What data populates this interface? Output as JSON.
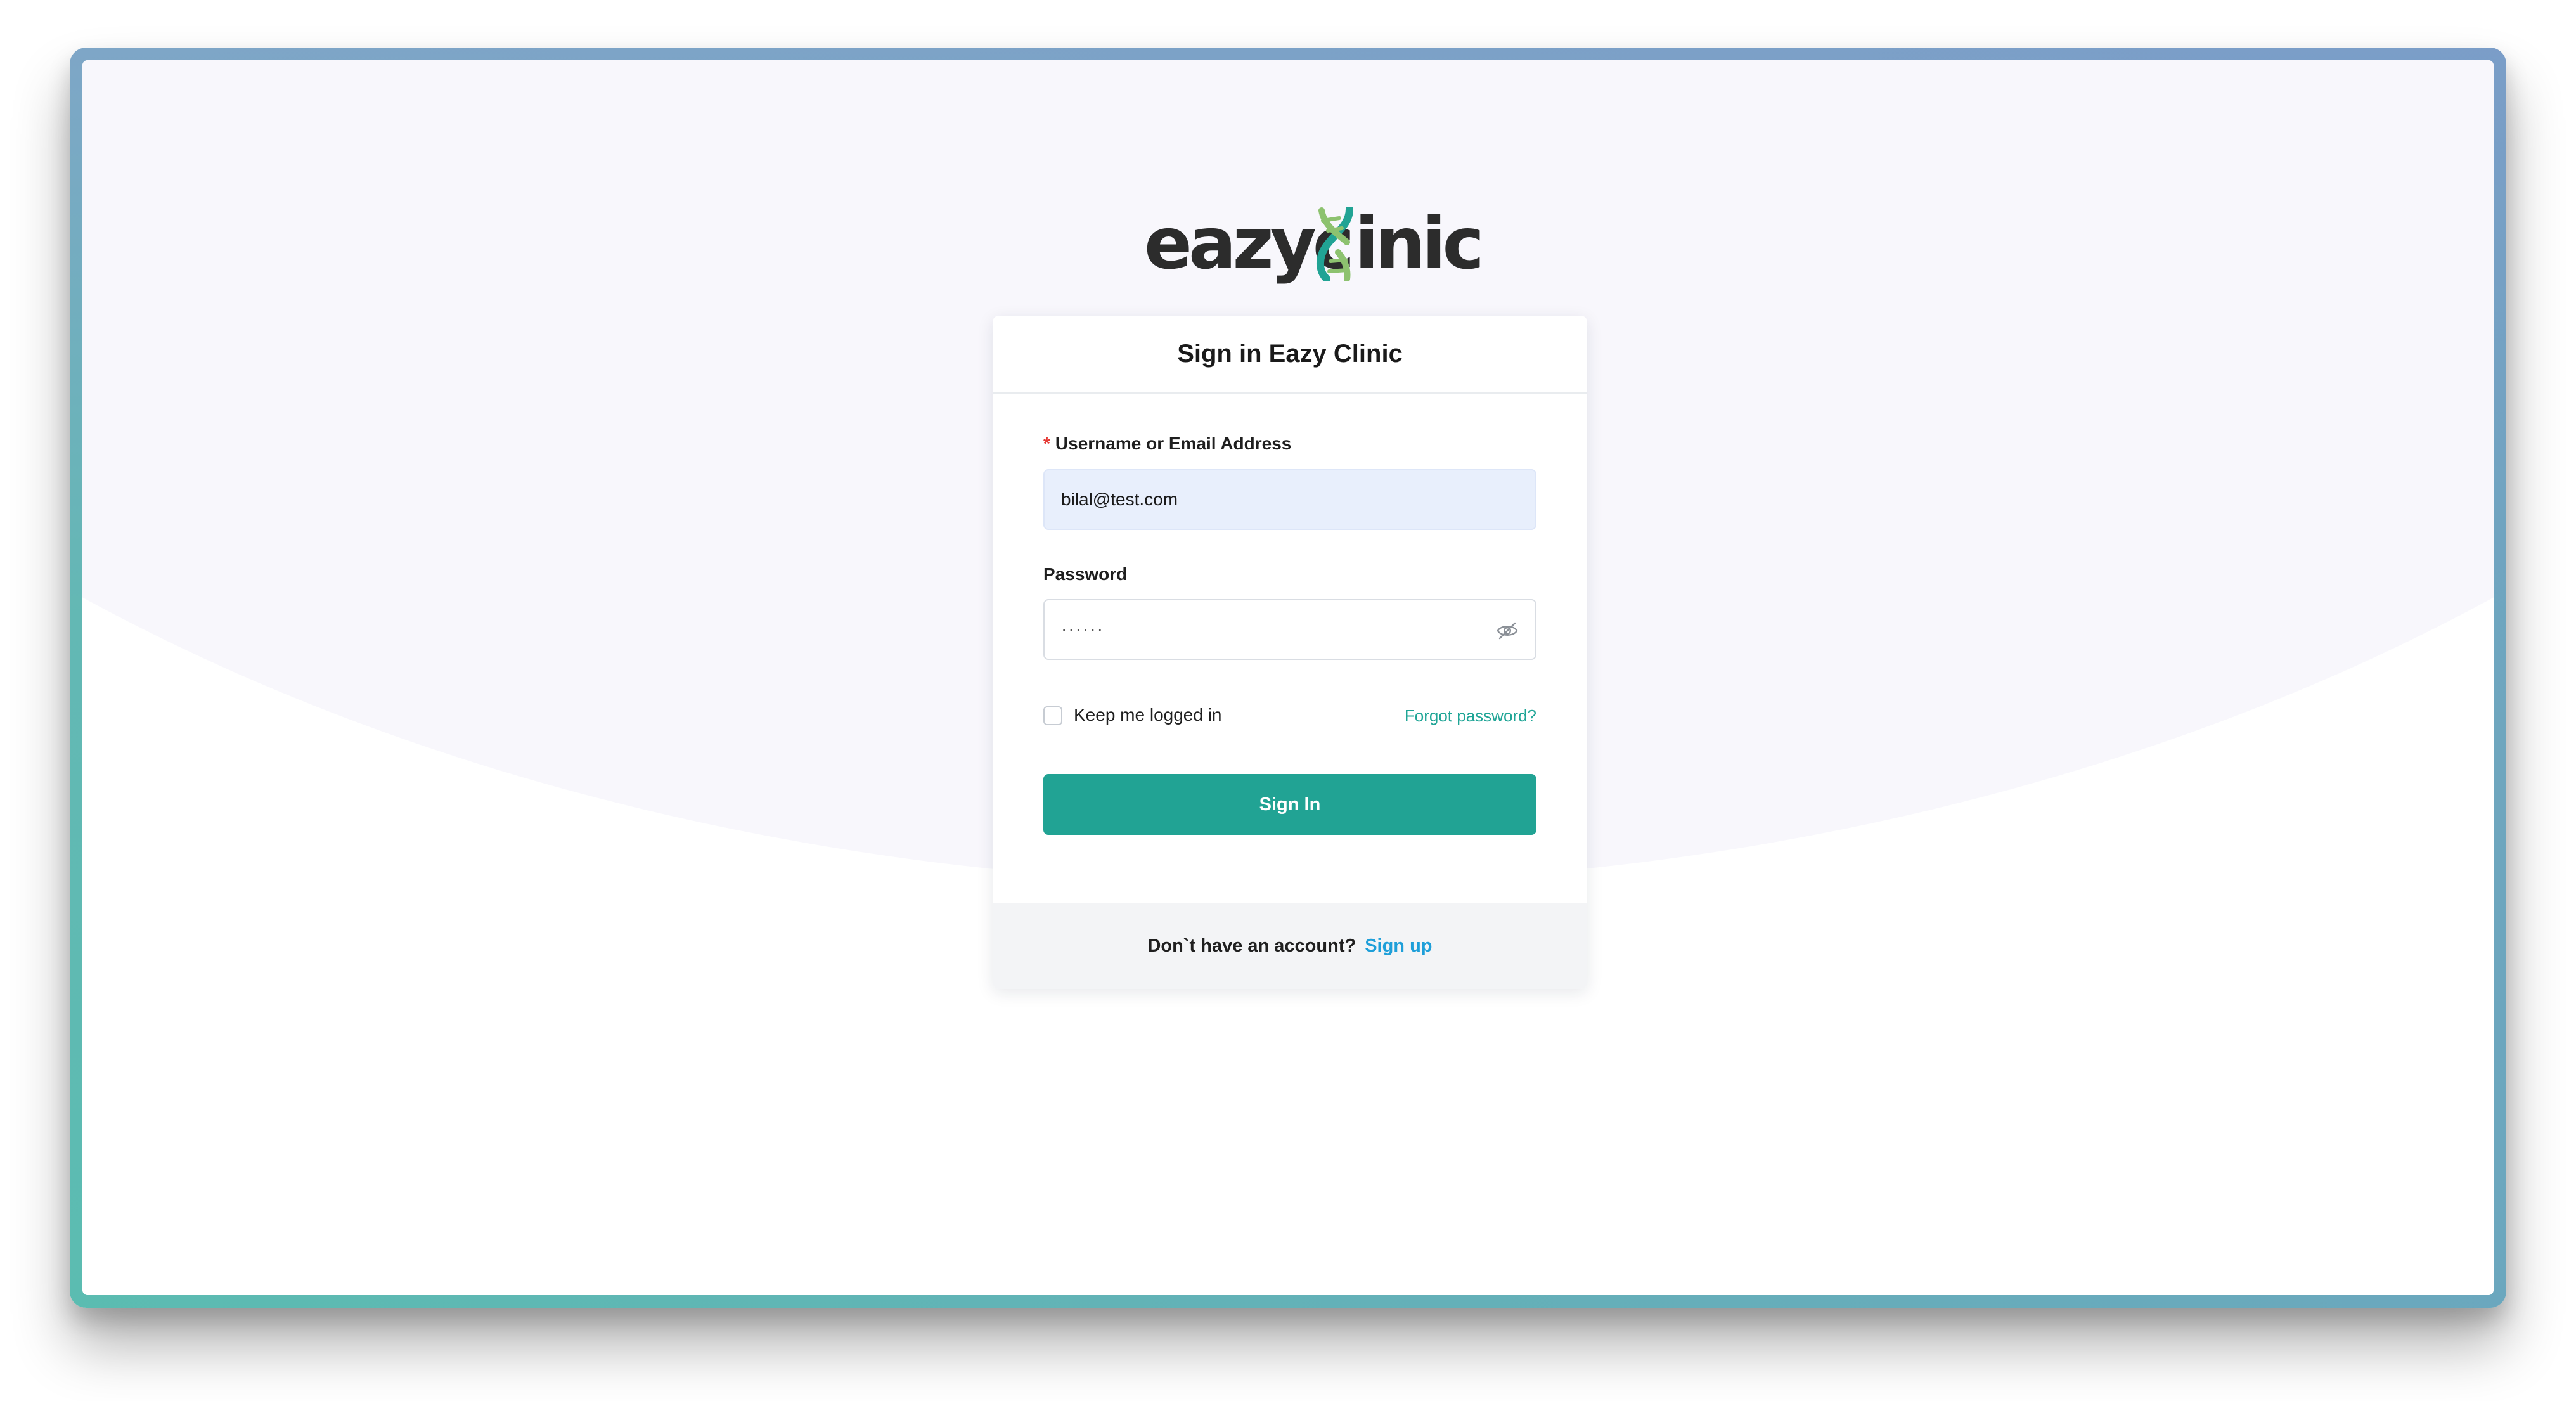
{
  "app": {
    "logo_text_left": "eazyc",
    "logo_text_right": "inic",
    "logo_colors": {
      "text": "#2c2c2c",
      "dna_teal": "#21a394",
      "dna_green": "#8dc26f"
    }
  },
  "card": {
    "title": "Sign in Eazy Clinic",
    "username": {
      "label": "Username or Email Address",
      "required_mark": "*",
      "value": "bilal@test.com"
    },
    "password": {
      "label": "Password",
      "masked_value": "······",
      "visibility_icon": "eye-off-icon"
    },
    "remember": {
      "label": "Keep me logged in",
      "checked": false
    },
    "forgot_link": "Forgot password?",
    "submit_label": "Sign In",
    "footer": {
      "prompt": "Don`t have an account?",
      "signup_link": "Sign up"
    }
  },
  "colors": {
    "accent": "#21a394",
    "link_teal": "#1fa596",
    "link_blue": "#1e9fd9",
    "required": "#e53935",
    "input_autofill_bg": "#e8effc",
    "background_arc": "#f8f7fc"
  }
}
